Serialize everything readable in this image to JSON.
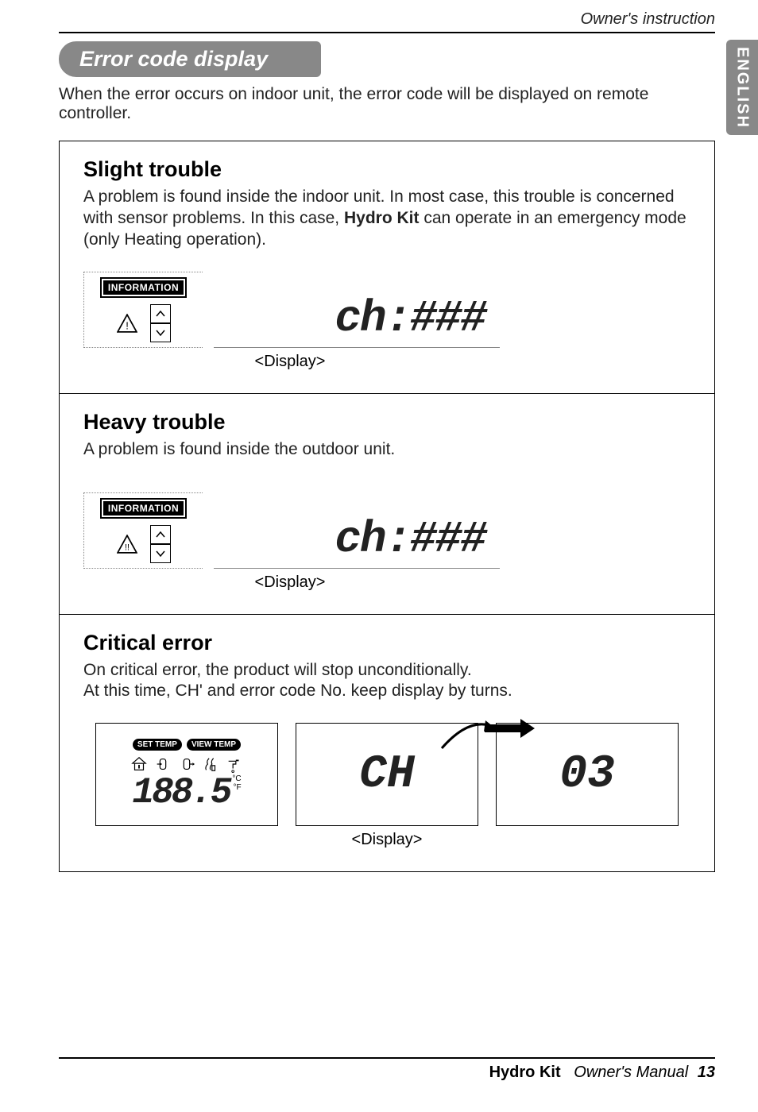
{
  "header": {
    "owner_instruction": "Owner's instruction",
    "side_tab": "ENGLISH"
  },
  "title": "Error code display",
  "intro": "When the error occurs on indoor unit, the error code will be displayed on remote controller.",
  "sections": {
    "slight": {
      "title": "Slight trouble",
      "body_pre": "A problem is found inside the indoor unit. In most case, this trouble is concerned with sensor problems. In this case, ",
      "body_bold": "Hydro Kit",
      "body_post": " can operate in an emergency mode (only Heating operation).",
      "info_label": "INFORMATION",
      "warn_mark": "!",
      "lcd": "ch:###",
      "caption": "<Display>"
    },
    "heavy": {
      "title": "Heavy trouble",
      "body": "A problem is found inside the outdoor unit.",
      "info_label": "INFORMATION",
      "warn_mark": "!!",
      "lcd": "ch:###",
      "caption": "<Display>"
    },
    "critical": {
      "title": "Critical error",
      "body_l1": "On critical error, the product will stop unconditionally.",
      "body_l2": "At this time, CH' and error code No. keep display by turns.",
      "set_temp": "SET TEMP",
      "view_temp": "VIEW TEMP",
      "unit_c": "°C",
      "unit_f": "°F",
      "seg1": "188.5",
      "seg2": "CH",
      "seg3": "03",
      "caption": "<Display>"
    }
  },
  "footer": {
    "product": "Hydro Kit",
    "manual": "Owner's Manual",
    "page": "13"
  }
}
